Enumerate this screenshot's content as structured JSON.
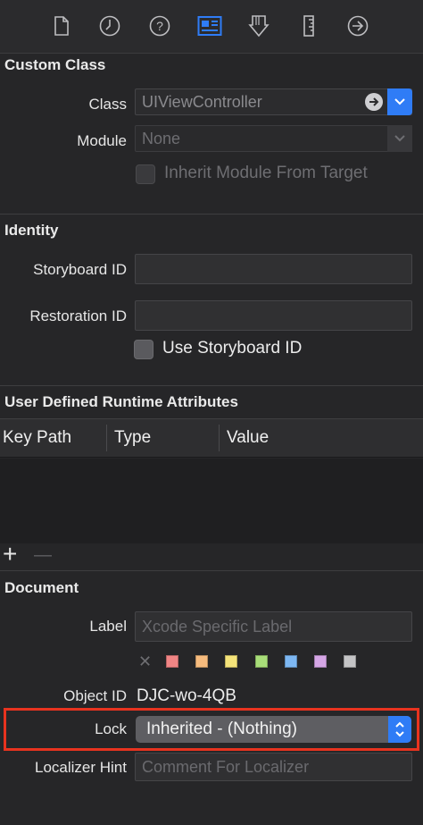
{
  "tabs": [
    {
      "icon": "file-inspector-icon"
    },
    {
      "icon": "history-inspector-icon"
    },
    {
      "icon": "quick-help-icon"
    },
    {
      "icon": "identity-inspector-icon",
      "selected": true
    },
    {
      "icon": "attributes-inspector-icon"
    },
    {
      "icon": "size-inspector-icon"
    },
    {
      "icon": "connections-inspector-icon"
    }
  ],
  "custom_class": {
    "title": "Custom Class",
    "class_label": "Class",
    "class_value": "UIViewController",
    "module_label": "Module",
    "module_value": "None",
    "inherit_label": "Inherit Module From Target"
  },
  "identity": {
    "title": "Identity",
    "storyboard_id_label": "Storyboard ID",
    "storyboard_id_value": "",
    "restoration_id_label": "Restoration ID",
    "restoration_id_value": "",
    "use_storyboard_id_label": "Use Storyboard ID"
  },
  "runtime_attributes": {
    "title": "User Defined Runtime Attributes",
    "columns": [
      "Key Path",
      "Type",
      "Value"
    ],
    "add_symbol": "+",
    "remove_symbol": "—"
  },
  "document": {
    "title": "Document",
    "label_label": "Label",
    "label_placeholder": "Xcode Specific Label",
    "color_clear_symbol": "✕",
    "colors": [
      "#f08585",
      "#f6bb7e",
      "#f4e37a",
      "#a8dd79",
      "#7db7f2",
      "#d5a6e6",
      "#c4c4c6"
    ],
    "object_id_label": "Object ID",
    "object_id_value": "DJC-wo-4QB",
    "lock_label": "Lock",
    "lock_value": "Inherited - (Nothing)",
    "localizer_hint_label": "Localizer Hint",
    "localizer_hint_placeholder": "Comment For Localizer"
  },
  "colors": {
    "accent": "#2f7cf6",
    "highlight": "#e8331f"
  }
}
